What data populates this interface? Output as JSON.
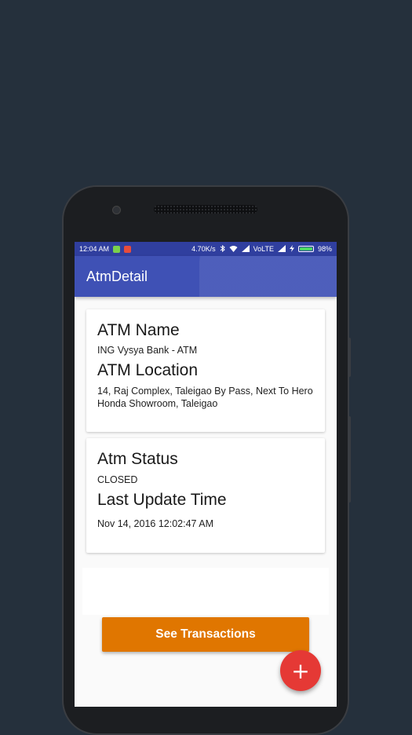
{
  "status_bar": {
    "time": "12:04 AM",
    "speed": "4.70K/s",
    "network": "VoLTE",
    "battery": "98%",
    "battery_level": 0.98,
    "icons": [
      "notification-icon",
      "youtube-icon",
      "bluetooth-icon",
      "wifi-icon",
      "signal-icon",
      "charging-icon"
    ]
  },
  "app_bar": {
    "title": "AtmDetail"
  },
  "card_info": {
    "name_heading": "ATM Name",
    "name_value": "ING Vysya Bank - ATM",
    "location_heading": "ATM Location",
    "location_value": "14, Raj Complex, Taleigao By Pass, Next To Hero Honda Showroom, Taleigao"
  },
  "card_status": {
    "status_heading": "Atm Status",
    "status_value": "CLOSED",
    "update_heading": "Last Update Time",
    "update_value": "Nov 14, 2016 12:02:47 AM"
  },
  "actions": {
    "see_transactions_label": "See Transactions",
    "fab_label": "+"
  },
  "colors": {
    "background": "#25303c",
    "status_bar": "#303f9f",
    "app_bar": "#3f51b5",
    "button": "#e07600",
    "fab": "#e53935"
  }
}
